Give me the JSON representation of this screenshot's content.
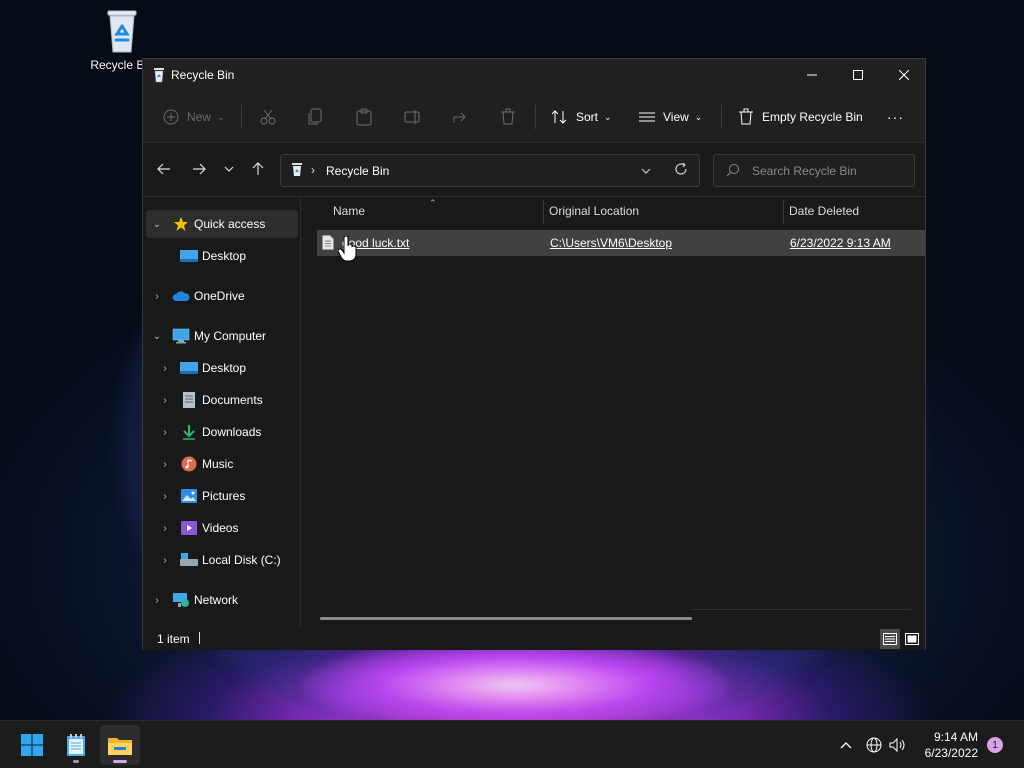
{
  "desktop": {
    "recycle_bin_label": "Recycle Bin"
  },
  "window": {
    "title": "Recycle Bin",
    "controls": {
      "minimize": "minimize",
      "maximize": "maximize",
      "close": "close"
    }
  },
  "toolbar": {
    "new_label": "New",
    "sort_label": "Sort",
    "view_label": "View",
    "empty_label": "Empty Recycle Bin",
    "more_label": "···"
  },
  "address": {
    "crumb": "Recycle Bin",
    "search_placeholder": "Search Recycle Bin"
  },
  "nav": {
    "quick_access": "Quick access",
    "qa_desktop": "Desktop",
    "onedrive": "OneDrive",
    "my_computer": "My Computer",
    "items": {
      "desktop": "Desktop",
      "documents": "Documents",
      "downloads": "Downloads",
      "music": "Music",
      "pictures": "Pictures",
      "videos": "Videos",
      "local_disk": "Local Disk (C:)"
    },
    "network": "Network"
  },
  "columns": {
    "name": "Name",
    "original_location": "Original Location",
    "date_deleted": "Date Deleted"
  },
  "files": [
    {
      "name": "good luck.txt",
      "original_location": "C:\\Users\\VM6\\Desktop",
      "date_deleted": "6/23/2022 9:13 AM"
    }
  ],
  "status": {
    "count": "1 item"
  },
  "taskbar": {
    "time": "9:14 AM",
    "date": "6/23/2022",
    "notifications": "1"
  },
  "colors": {
    "accent": "#60cdff",
    "window_bg": "#191919",
    "toolbar_bg": "#202020",
    "selected_row": "#414141"
  }
}
